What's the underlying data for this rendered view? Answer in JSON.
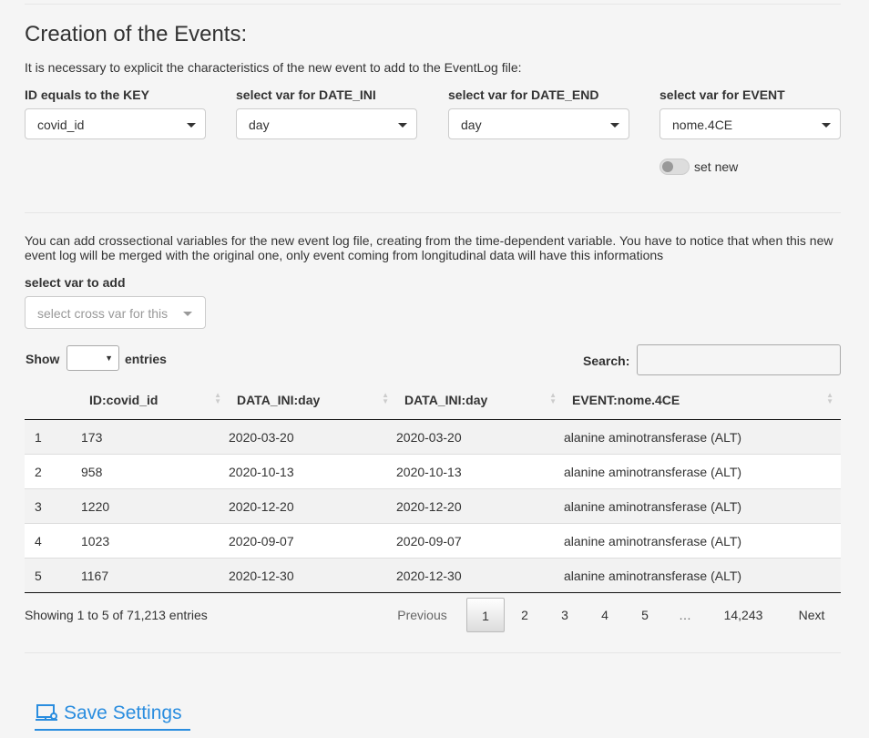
{
  "section": {
    "title": "Creation of the Events:",
    "intro": "It is necessary to explicit the characteristics of the new event to add to the EventLog file:"
  },
  "selects": [
    {
      "label": "ID equals to the KEY",
      "value": "covid_id"
    },
    {
      "label": "select var for DATE_INI",
      "value": "day"
    },
    {
      "label": "select var for DATE_END",
      "value": "day"
    },
    {
      "label": "select var for EVENT",
      "value": "nome.4CE"
    }
  ],
  "switch": {
    "label": "set new",
    "on": false
  },
  "cross": {
    "text": "You can add crossectional variables for the new event log file, creating from the time-dependent variable. You have to notice that when this new event log will be merged with the original one, only event coming from longitudinal data will have this informations",
    "label": "select var to add",
    "placeholder": "select cross var for this"
  },
  "table_controls": {
    "show_label": "Show",
    "entries_label": "entries",
    "search_label": "Search:",
    "search_value": ""
  },
  "table": {
    "headers": [
      "",
      "ID:covid_id",
      "DATA_INI:day",
      "DATA_INI:day",
      "EVENT:nome.4CE"
    ],
    "rows": [
      [
        "1",
        "173",
        "2020-03-20",
        "2020-03-20",
        "alanine aminotransferase (ALT)"
      ],
      [
        "2",
        "958",
        "2020-10-13",
        "2020-10-13",
        "alanine aminotransferase (ALT)"
      ],
      [
        "3",
        "1220",
        "2020-12-20",
        "2020-12-20",
        "alanine aminotransferase (ALT)"
      ],
      [
        "4",
        "1023",
        "2020-09-07",
        "2020-09-07",
        "alanine aminotransferase (ALT)"
      ],
      [
        "5",
        "1167",
        "2020-12-30",
        "2020-12-30",
        "alanine aminotransferase (ALT)"
      ]
    ]
  },
  "pagination": {
    "info": "Showing 1 to 5 of 71,213 entries",
    "previous": "Previous",
    "pages": [
      "1",
      "2",
      "3",
      "4",
      "5",
      "…",
      "14,243"
    ],
    "current": "1",
    "next": "Next"
  },
  "save": {
    "label": "Save Settings",
    "icon": "save-settings-icon",
    "color": "#2a8ddf"
  }
}
